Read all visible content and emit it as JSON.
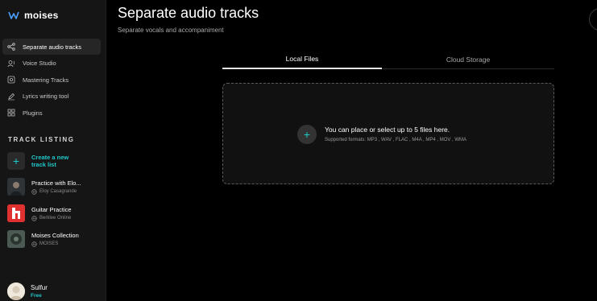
{
  "app": {
    "name": "moises"
  },
  "nav": [
    {
      "label": "Separate audio tracks",
      "icon": "share-nodes-icon",
      "active": true
    },
    {
      "label": "Voice Studio",
      "icon": "voice-icon"
    },
    {
      "label": "Mastering Tracks",
      "icon": "mastering-icon"
    },
    {
      "label": "Lyrics writing tool",
      "icon": "pen-icon"
    },
    {
      "label": "Plugins",
      "icon": "grid-icon"
    }
  ],
  "track_listing": {
    "title": "TRACK LISTING",
    "create_label": "Create a new track list",
    "tracks": [
      {
        "name": "Practice with Elo...",
        "owner": "Eloy Casagrande"
      },
      {
        "name": "Guitar Practice",
        "owner": "Berklee Online"
      },
      {
        "name": "Moises Collection",
        "owner": "MOISES"
      }
    ]
  },
  "user": {
    "name": "Sulfur",
    "plan": "Free"
  },
  "main": {
    "title": "Separate audio tracks",
    "subtitle": "Separate vocals and accompaniment",
    "tabs": [
      "Local Files",
      "Cloud Storage"
    ],
    "dropzone": {
      "title": "You can place or select up to 5 files here.",
      "formats": "Supported formats: MP3 , WAV , FLAC , M4A , MP4 , MOV , WMA"
    }
  },
  "colors": {
    "accent": "#1fc7c9",
    "sidebar": "#151515",
    "background": "#000000"
  }
}
